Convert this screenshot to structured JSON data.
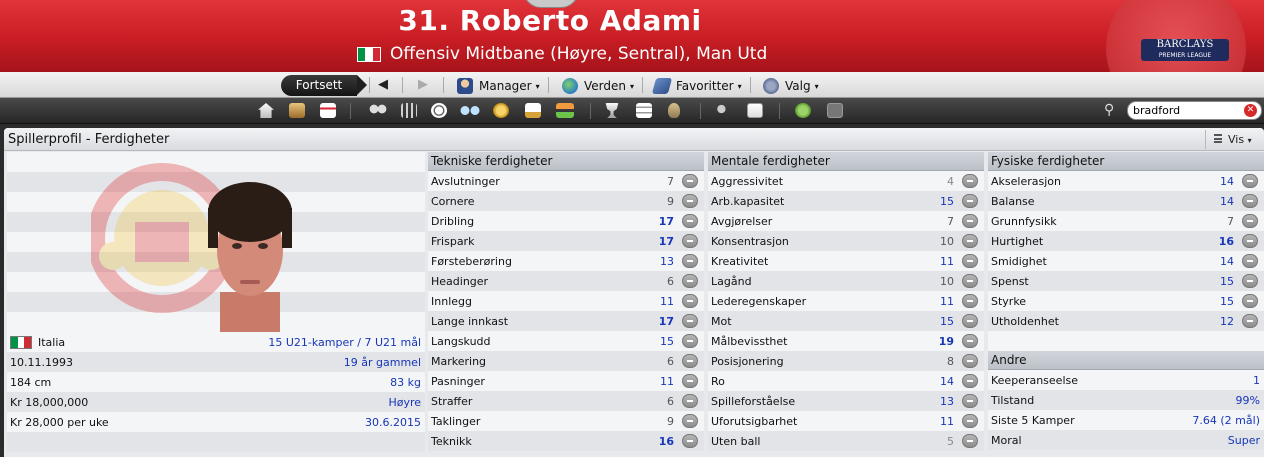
{
  "header": {
    "player_title": "31. Roberto Adami",
    "subtitle": "Offensiv Midtbane (Høyre, Sentral), Man Utd",
    "league_logo": "BARCLAYS",
    "league_logo_sub": "PREMIER LEAGUE"
  },
  "nav": {
    "continue_label": "Fortsett",
    "back_icon": "◀",
    "forward_icon": "▶",
    "menus": [
      {
        "label": "Manager",
        "icon": "manager-icon"
      },
      {
        "label": "Verden",
        "icon": "globe-icon"
      },
      {
        "label": "Favoritter",
        "icon": "book-icon"
      },
      {
        "label": "Valg",
        "icon": "gears-icon"
      }
    ],
    "caret": "▾"
  },
  "toolbar": {
    "search_value": "bradford",
    "clear_icon": "✕"
  },
  "panel": {
    "title": "Spillerprofil - Ferdigheter",
    "view_label": "Vis"
  },
  "profile": {
    "nationality": "Italia",
    "u21": "15 U21-kamper / 7 U21 mål",
    "dob": "10.11.1993",
    "age": "19 år gammel",
    "height": "184 cm",
    "weight": "83 kg",
    "value": "Kr 18,000,000",
    "foot": "Høyre",
    "wage": "Kr 28,000 per uke",
    "contract": "30.6.2015"
  },
  "technical": {
    "title": "Tekniske ferdigheter",
    "rows": [
      {
        "name": "Avslutninger",
        "value": "7"
      },
      {
        "name": "Cornere",
        "value": "9"
      },
      {
        "name": "Dribling",
        "value": "17"
      },
      {
        "name": "Frispark",
        "value": "17"
      },
      {
        "name": "Førsteberøring",
        "value": "13"
      },
      {
        "name": "Headinger",
        "value": "6"
      },
      {
        "name": "Innlegg",
        "value": "11"
      },
      {
        "name": "Lange innkast",
        "value": "17"
      },
      {
        "name": "Langskudd",
        "value": "15"
      },
      {
        "name": "Markering",
        "value": "6"
      },
      {
        "name": "Pasninger",
        "value": "11"
      },
      {
        "name": "Straffer",
        "value": "6"
      },
      {
        "name": "Taklinger",
        "value": "9"
      },
      {
        "name": "Teknikk",
        "value": "16"
      }
    ]
  },
  "mental": {
    "title": "Mentale ferdigheter",
    "rows": [
      {
        "name": "Aggressivitet",
        "value": "4"
      },
      {
        "name": "Arb.kapasitet",
        "value": "15"
      },
      {
        "name": "Avgjørelser",
        "value": "7"
      },
      {
        "name": "Konsentrasjon",
        "value": "10"
      },
      {
        "name": "Kreativitet",
        "value": "11"
      },
      {
        "name": "Lagånd",
        "value": "10"
      },
      {
        "name": "Lederegenskaper",
        "value": "11"
      },
      {
        "name": "Mot",
        "value": "15"
      },
      {
        "name": "Målbevissthet",
        "value": "19"
      },
      {
        "name": "Posisjonering",
        "value": "8"
      },
      {
        "name": "Ro",
        "value": "14"
      },
      {
        "name": "Spilleforståelse",
        "value": "13"
      },
      {
        "name": "Uforutsigbarhet",
        "value": "11"
      },
      {
        "name": "Uten ball",
        "value": "5"
      }
    ]
  },
  "physical": {
    "title": "Fysiske ferdigheter",
    "rows": [
      {
        "name": "Akselerasjon",
        "value": "14"
      },
      {
        "name": "Balanse",
        "value": "14"
      },
      {
        "name": "Grunnfysikk",
        "value": "7"
      },
      {
        "name": "Hurtighet",
        "value": "16"
      },
      {
        "name": "Smidighet",
        "value": "14"
      },
      {
        "name": "Spenst",
        "value": "15"
      },
      {
        "name": "Styrke",
        "value": "15"
      },
      {
        "name": "Utholdenhet",
        "value": "12"
      }
    ]
  },
  "other": {
    "title": "Andre",
    "rows": [
      {
        "name": "Keeperanseelse",
        "value": "1"
      },
      {
        "name": "Tilstand",
        "value": "99%"
      },
      {
        "name": "Siste 5 Kamper",
        "value": "7.64 (2 mål)"
      },
      {
        "name": "Moral",
        "value": "Super"
      }
    ]
  },
  "colors": {
    "header_red": "#c81d24",
    "attr_blue": "#1736b8"
  }
}
